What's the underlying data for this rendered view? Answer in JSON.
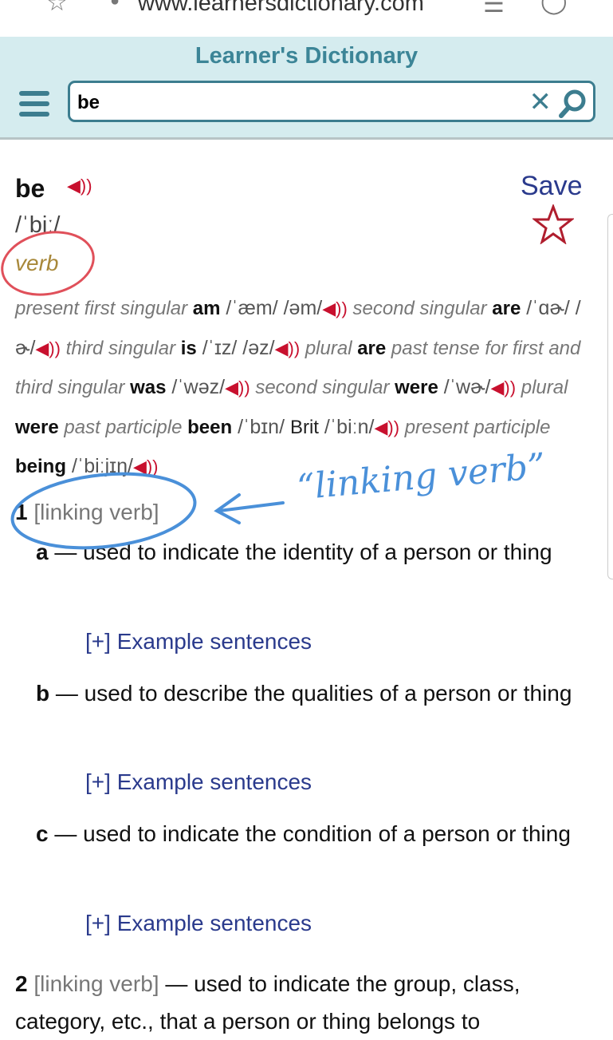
{
  "browser": {
    "url": "www.learnersdictionary.com"
  },
  "header": {
    "title": "Learner's Dictionary",
    "search_value": "be",
    "search_placeholder": "Search"
  },
  "entry": {
    "headword": "be",
    "pronunciation": "/ˈbiː/",
    "part_of_speech": "verb",
    "save_label": "Save",
    "inflections": [
      {
        "t": "label",
        "v": "present first singular "
      },
      {
        "t": "word",
        "v": "am"
      },
      {
        "t": "pr",
        "v": " /ˈæm/ /əm/"
      },
      {
        "t": "spk"
      },
      {
        "t": "label",
        "v": " second singular "
      },
      {
        "t": "word",
        "v": "are"
      },
      {
        "t": "pr",
        "v": " /ˈɑɚ/ /ɚ/"
      },
      {
        "t": "spk"
      },
      {
        "t": "label",
        "v": " third singular "
      },
      {
        "t": "word",
        "v": "is"
      },
      {
        "t": "pr",
        "v": " /ˈɪz/ /əz/"
      },
      {
        "t": "spk"
      },
      {
        "t": "label",
        "v": " plural "
      },
      {
        "t": "word",
        "v": "are"
      },
      {
        "t": "label",
        "v": " past tense for first and third singular "
      },
      {
        "t": "word",
        "v": "was"
      },
      {
        "t": "pr",
        "v": " /ˈwəz/"
      },
      {
        "t": "spk"
      },
      {
        "t": "label",
        "v": " second singular "
      },
      {
        "t": "word",
        "v": "were"
      },
      {
        "t": "pr",
        "v": " /ˈwɚ/"
      },
      {
        "t": "spk"
      },
      {
        "t": "label",
        "v": " plural "
      },
      {
        "t": "word",
        "v": "were"
      },
      {
        "t": "label",
        "v": " past participle "
      },
      {
        "t": "word",
        "v": "been"
      },
      {
        "t": "pr",
        "v": " /ˈbɪn/ "
      },
      {
        "t": "plain",
        "v": "Brit"
      },
      {
        "t": "pr",
        "v": " /ˈbiːn/"
      },
      {
        "t": "spk"
      },
      {
        "t": "label",
        "v": " present participle "
      },
      {
        "t": "word",
        "v": "being"
      },
      {
        "t": "pr",
        "v": " /ˈbiːjɪŋ/"
      },
      {
        "t": "spk"
      }
    ],
    "senses": [
      {
        "num": "1",
        "label": "linking verb",
        "subs": [
          {
            "letter": "a",
            "def": "used to indicate the identity of a person or thing",
            "example": "[+] Example sentences"
          },
          {
            "letter": "b",
            "def": "used to describe the qualities of a person or thing",
            "example": "[+] Example sentences"
          },
          {
            "letter": "c",
            "def": "used to indicate the condition of a person or thing",
            "example": "[+] Example sentences"
          }
        ]
      },
      {
        "num": "2",
        "label": "linking verb",
        "def": "used to indicate the group, class, category, etc., that a person or thing belongs to"
      }
    ]
  },
  "annotation": {
    "handwritten": "“linking verb”",
    "colors": {
      "red": "#e0505a",
      "blue": "#4a90d9"
    }
  }
}
